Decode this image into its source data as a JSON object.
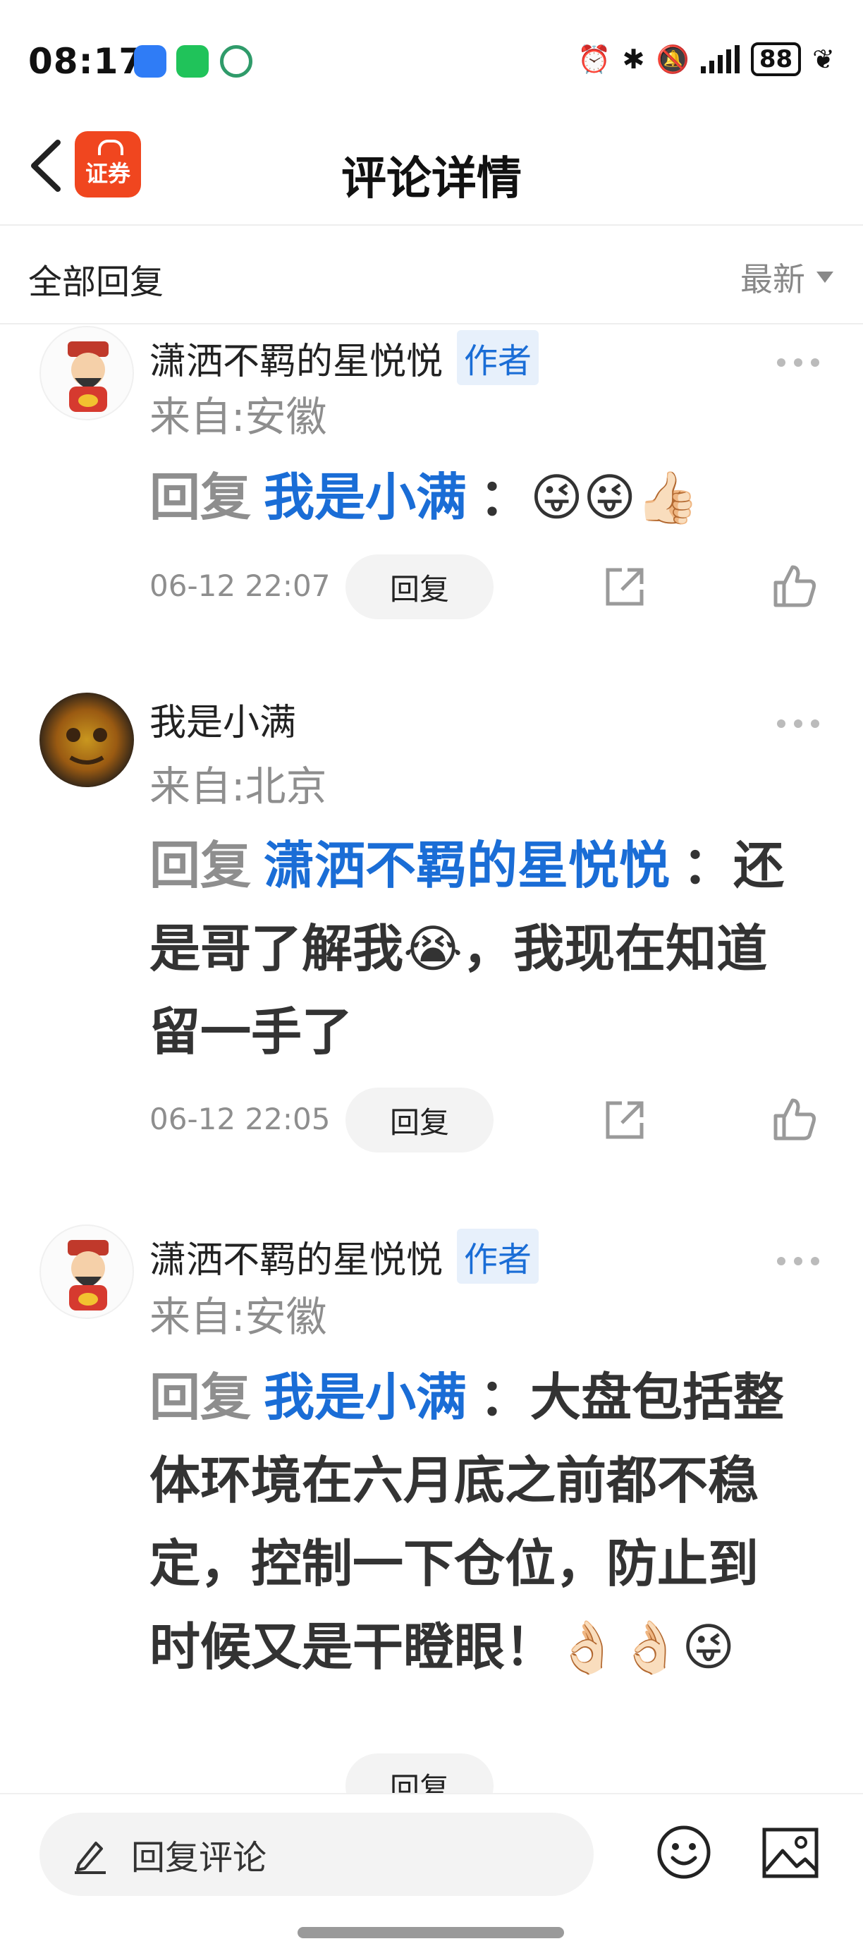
{
  "status_bar": {
    "time": "08:17",
    "battery": "88",
    "left_icons": [
      "message-icon",
      "wechat-icon",
      "yuan-icon"
    ],
    "right_icons": [
      "alarm-icon",
      "bluetooth-icon",
      "mute-icon",
      "signal-icon",
      "battery-icon",
      "leaf-icon"
    ]
  },
  "nav": {
    "title": "评论详情",
    "logo_text": "证券"
  },
  "sort_bar": {
    "label": "全部回复",
    "sort_value": "最新"
  },
  "comments": [
    {
      "username": "潇洒不羁的星悦悦",
      "badge": "作者",
      "location": "来自:安徽",
      "reply_prefix": "回复",
      "mention": "我是小满",
      "text": "：😜😜👍🏻",
      "date": "06-12 22:07",
      "reply_button": "回复"
    },
    {
      "username": "我是小满",
      "badge": "",
      "location": "来自:北京",
      "reply_prefix": "回复",
      "mention": "潇洒不羁的星悦悦",
      "text": "：还是哥了解我😭，我现在知道留一手了",
      "date": "06-12 22:05",
      "reply_button": "回复"
    },
    {
      "username": "潇洒不羁的星悦悦",
      "badge": "作者",
      "location": "来自:安徽",
      "reply_prefix": "回复",
      "mention": "我是小满",
      "text": "：大盘包括整体环境在六月底之前都不稳定，控制一下仓位，防止到时候又是干瞪眼！👌🏻👌🏻😜",
      "date": "",
      "reply_button": "回复"
    }
  ],
  "bottom_bar": {
    "input_placeholder": "回复评论"
  }
}
